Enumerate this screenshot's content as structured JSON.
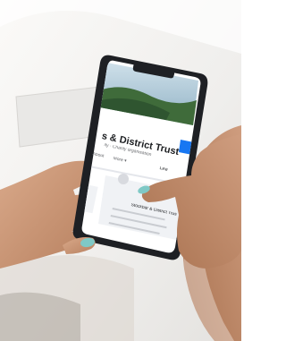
{
  "screen": {
    "page_title": "s & District Trust",
    "page_subtitle": "ity · Charity organisation",
    "tabs": [
      "About",
      "More ▾"
    ],
    "like_label": "Like",
    "post_title": "Stockbar & District Trust"
  },
  "colors": {
    "background": "#f4f3f1",
    "phone_frame": "#1e2024",
    "screen": "#ffffff",
    "accent": "#1877f2",
    "skin": "#c79677",
    "nails": "#7fc9c6"
  }
}
